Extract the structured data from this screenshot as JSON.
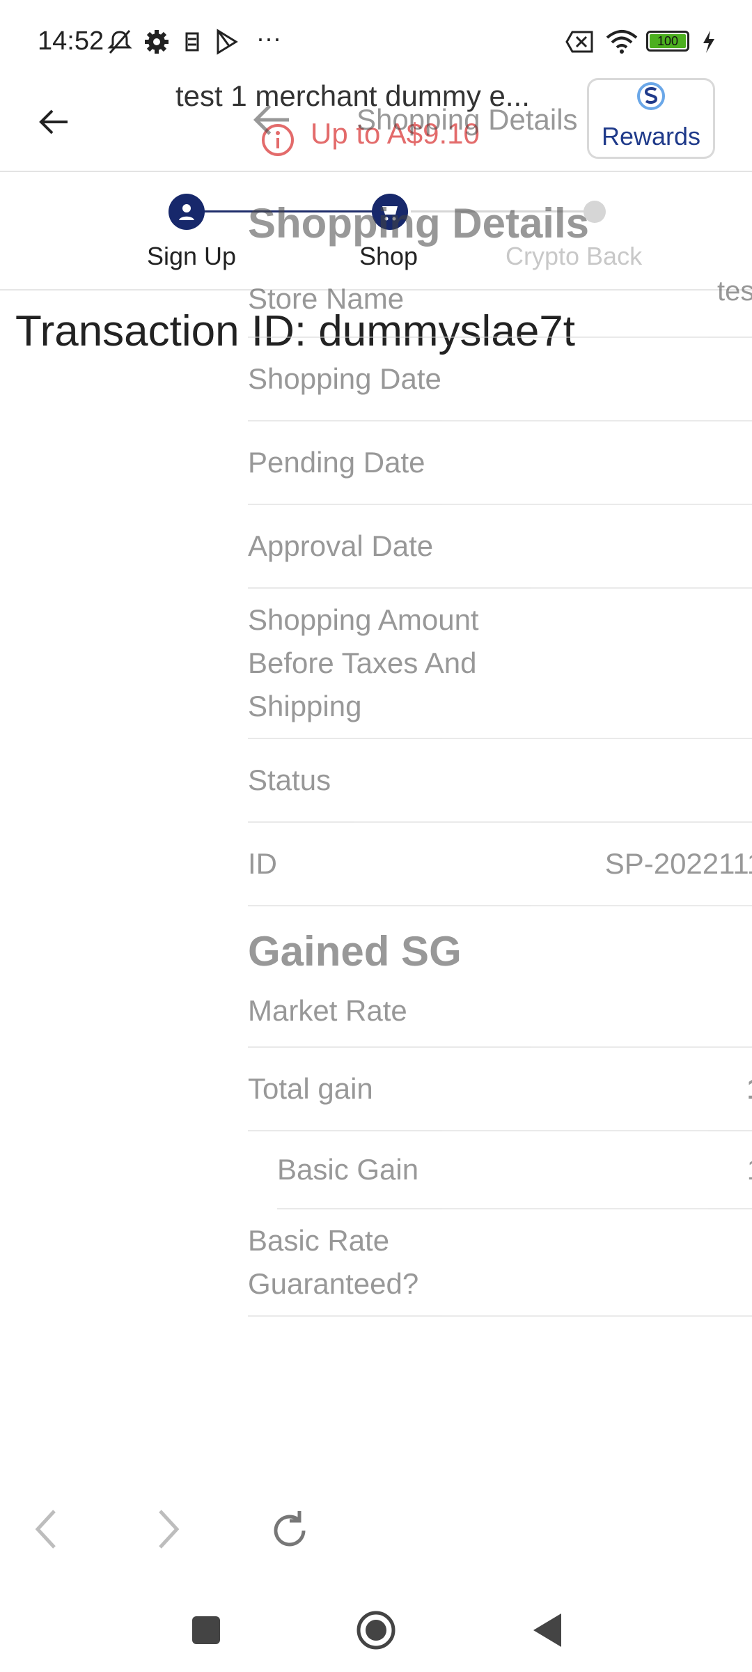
{
  "status_bar": {
    "time": "14:52",
    "left_icons": [
      "bell-off-icon",
      "gear-icon",
      "app-icon",
      "play-store-icon",
      "more-dots-icon"
    ],
    "right_icons": [
      "sim-off-icon",
      "wifi-icon",
      "battery-icon",
      "charging-icon"
    ],
    "battery": "100",
    "more": "···"
  },
  "header": {
    "title": "test 1 merchant dummy e...",
    "subtitle": "Up to A$9.10",
    "rewards_label": "Rewards"
  },
  "stepper": {
    "steps": [
      {
        "label": "Sign Up",
        "state": "done",
        "icon": "person-icon"
      },
      {
        "label": "Shop",
        "state": "done",
        "icon": "cart-icon"
      },
      {
        "label": "Crypto Back",
        "state": "pending",
        "icon": "dot-icon"
      }
    ],
    "color_active": "#17286b",
    "color_inactive": "#d6d6d6"
  },
  "transaction": {
    "text": "Transaction ID: dummyslae7t"
  },
  "ghost_panel": {
    "header_title": "Shopping Details",
    "section_title": "Shopping Details",
    "store_name_value": "tes",
    "rows": [
      {
        "label": "Store Name",
        "value": ""
      },
      {
        "label": "Shopping Date",
        "value": ""
      },
      {
        "label": "Pending Date",
        "value": ""
      },
      {
        "label": "Approval Date",
        "value": ""
      },
      {
        "label": "Shopping Amount Before Taxes And Shipping",
        "value": ""
      },
      {
        "label": "Status",
        "value": ""
      },
      {
        "label": "ID",
        "value": "SP-2022111"
      }
    ],
    "gained_title": "Gained SG",
    "gained_rows": [
      {
        "label": "Market Rate",
        "value": ""
      },
      {
        "label": "Total gain",
        "value": "1"
      },
      {
        "label": "Basic Gain",
        "value": "1"
      },
      {
        "label": "Basic Rate Guaranteed?",
        "value": ""
      }
    ]
  },
  "browser_bar": {
    "buttons": [
      "chevron-left-icon",
      "chevron-right-icon",
      "reload-icon"
    ]
  },
  "nav_bar": {
    "buttons": [
      "recents-icon",
      "home-icon",
      "back-triangle-icon"
    ]
  }
}
